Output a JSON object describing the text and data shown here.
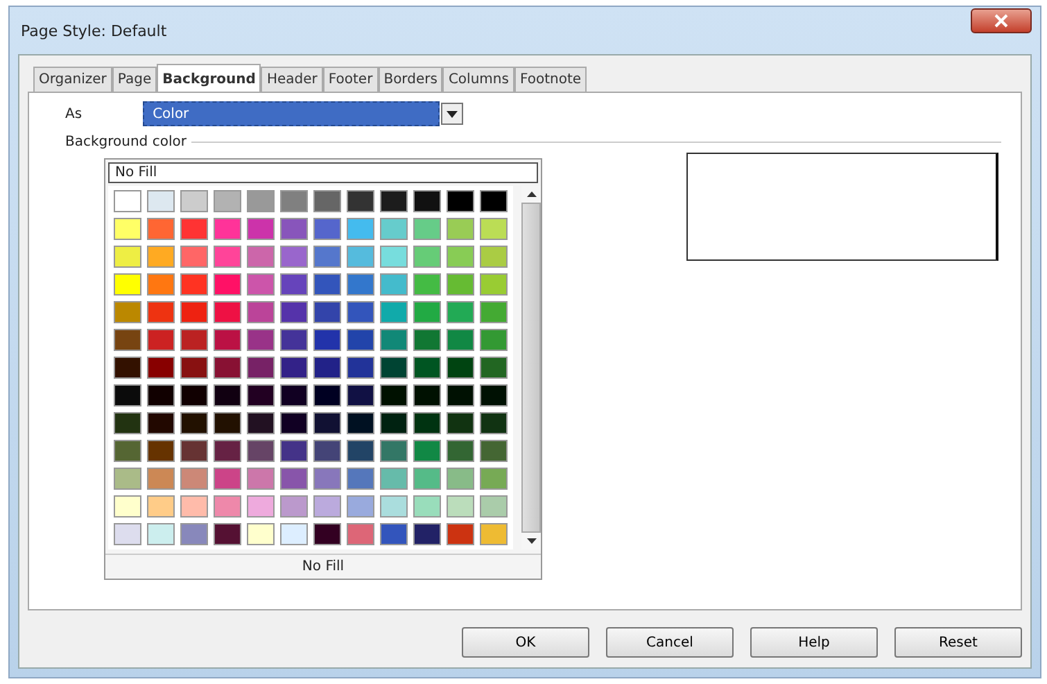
{
  "window": {
    "title": "Page Style: Default"
  },
  "tabs": [
    {
      "label": "Organizer",
      "selected": false
    },
    {
      "label": "Page",
      "selected": false
    },
    {
      "label": "Background",
      "selected": true
    },
    {
      "label": "Header",
      "selected": false
    },
    {
      "label": "Footer",
      "selected": false
    },
    {
      "label": "Borders",
      "selected": false
    },
    {
      "label": "Columns",
      "selected": false
    },
    {
      "label": "Footnote",
      "selected": false
    }
  ],
  "as_field": {
    "label": "As",
    "value": "Color"
  },
  "section_title": "Background color",
  "palette": {
    "top_value": "No Fill",
    "bottom_label": "No Fill",
    "rows": [
      [
        {
          "color": "#ffffff"
        },
        {
          "color": "#dde8f0"
        },
        {
          "color": "#cccccc"
        },
        {
          "color": "#b2b2b2"
        },
        {
          "color": "#999999"
        },
        {
          "color": "#808080"
        },
        {
          "color": "#666666"
        },
        {
          "color": "#333333"
        },
        {
          "color": "#1c1c1c"
        },
        {
          "color": "#111111"
        },
        {
          "color": "#000000"
        },
        {
          "color": "#000000"
        }
      ],
      [
        {
          "color": "#ffff66"
        },
        {
          "color": "#ff6633"
        },
        {
          "color": "#ff3333"
        },
        {
          "color": "#ff3399"
        },
        {
          "color": "#cc33aa"
        },
        {
          "color": "#8855bb"
        },
        {
          "color": "#5566cc"
        },
        {
          "color": "#44bbee"
        },
        {
          "color": "#66cccc"
        },
        {
          "color": "#66cc88"
        },
        {
          "color": "#99cc55"
        },
        {
          "color": "#bbdd55"
        }
      ],
      [
        {
          "color": "#eeee44"
        },
        {
          "color": "#ffaa22"
        },
        {
          "color": "#ff6666"
        },
        {
          "color": "#ff4499"
        },
        {
          "color": "#cc66aa"
        },
        {
          "color": "#9966cc"
        },
        {
          "color": "#5577cc"
        },
        {
          "color": "#55bbdd"
        },
        {
          "color": "#77dddd"
        },
        {
          "color": "#66cc77"
        },
        {
          "color": "#88cc55"
        },
        {
          "color": "#aacc44"
        }
      ],
      [
        {
          "color": "#ffff00"
        },
        {
          "color": "#ff7711"
        },
        {
          "color": "#ff3322"
        },
        {
          "color": "#ff1166"
        },
        {
          "color": "#cc55aa"
        },
        {
          "color": "#6644bb"
        },
        {
          "color": "#3355bb"
        },
        {
          "color": "#3377cc"
        },
        {
          "color": "#44bbcc"
        },
        {
          "color": "#44bb44"
        },
        {
          "color": "#66bb33"
        },
        {
          "color": "#99cc33"
        }
      ],
      [
        {
          "color": "#bb8800"
        },
        {
          "color": "#ee3311"
        },
        {
          "color": "#ee2211"
        },
        {
          "color": "#ee1144"
        },
        {
          "color": "#bb4499"
        },
        {
          "color": "#5533aa"
        },
        {
          "color": "#3344aa"
        },
        {
          "color": "#3355bb"
        },
        {
          "color": "#11aaaa"
        },
        {
          "color": "#22aa44"
        },
        {
          "color": "#22aa55"
        },
        {
          "color": "#44aa33"
        }
      ],
      [
        {
          "color": "#774411"
        },
        {
          "color": "#cc2222"
        },
        {
          "color": "#bb2222"
        },
        {
          "color": "#bb1144"
        },
        {
          "color": "#993388"
        },
        {
          "color": "#443399"
        },
        {
          "color": "#2233aa"
        },
        {
          "color": "#2244aa"
        },
        {
          "color": "#118877"
        },
        {
          "color": "#117733"
        },
        {
          "color": "#118844"
        },
        {
          "color": "#339933"
        }
      ],
      [
        {
          "color": "#331100"
        },
        {
          "color": "#880000"
        },
        {
          "color": "#881111"
        },
        {
          "color": "#881133"
        },
        {
          "color": "#772266"
        },
        {
          "color": "#332288"
        },
        {
          "color": "#222288"
        },
        {
          "color": "#223399"
        },
        {
          "color": "#004433"
        },
        {
          "color": "#005522"
        },
        {
          "color": "#004411"
        },
        {
          "color": "#226622"
        }
      ],
      [
        {
          "color": "#0b0b0b"
        },
        {
          "color": "#110000"
        },
        {
          "color": "#110001"
        },
        {
          "color": "#110011"
        },
        {
          "color": "#220022"
        },
        {
          "color": "#110022"
        },
        {
          "color": "#000022"
        },
        {
          "color": "#111144"
        },
        {
          "color": "#001100"
        },
        {
          "color": "#001101"
        },
        {
          "color": "#001102"
        },
        {
          "color": "#001103"
        }
      ],
      [
        {
          "color": "#223311"
        },
        {
          "color": "#220800"
        },
        {
          "color": "#221100"
        },
        {
          "color": "#221101"
        },
        {
          "color": "#221122"
        },
        {
          "color": "#110023"
        },
        {
          "color": "#111133"
        },
        {
          "color": "#001122"
        },
        {
          "color": "#002211"
        },
        {
          "color": "#003311"
        },
        {
          "color": "#113311"
        },
        {
          "color": "#113312"
        }
      ],
      [
        {
          "color": "#556633"
        },
        {
          "color": "#663300"
        },
        {
          "color": "#663333"
        },
        {
          "color": "#662244"
        },
        {
          "color": "#664466"
        },
        {
          "color": "#443388"
        },
        {
          "color": "#444477"
        },
        {
          "color": "#224466"
        },
        {
          "color": "#337766"
        },
        {
          "color": "#118845"
        },
        {
          "color": "#336633"
        },
        {
          "color": "#446633"
        }
      ],
      [
        {
          "color": "#aabb88"
        },
        {
          "color": "#cc8855"
        },
        {
          "color": "#cc8877"
        },
        {
          "color": "#cc4488"
        },
        {
          "color": "#cc77aa"
        },
        {
          "color": "#8855aa"
        },
        {
          "color": "#8877bb"
        },
        {
          "color": "#5577bb"
        },
        {
          "color": "#66bbaa"
        },
        {
          "color": "#55bb88"
        },
        {
          "color": "#88bb88"
        },
        {
          "color": "#77aa55"
        }
      ],
      [
        {
          "color": "#ffffcc"
        },
        {
          "color": "#ffcc88"
        },
        {
          "color": "#ffbbaa"
        },
        {
          "color": "#ee88aa"
        },
        {
          "color": "#eeaadd"
        },
        {
          "color": "#bb99cc"
        },
        {
          "color": "#bbaadd"
        },
        {
          "color": "#99aadd"
        },
        {
          "color": "#aadddd"
        },
        {
          "color": "#99ddbb"
        },
        {
          "color": "#bbddbb"
        },
        {
          "color": "#aaccaa"
        }
      ],
      [
        {
          "color": "#ddddee"
        },
        {
          "color": "#cceeee"
        },
        {
          "color": "#8888bb"
        },
        {
          "color": "#551133"
        },
        {
          "color": "#ffffcd"
        },
        {
          "color": "#ddeeff"
        },
        {
          "color": "#330022"
        },
        {
          "color": "#dd6677"
        },
        {
          "color": "#3355bc"
        },
        {
          "color": "#222266"
        },
        {
          "color": "#cc3311"
        },
        {
          "color": "#eebb33"
        }
      ]
    ]
  },
  "buttons": [
    "OK",
    "Cancel",
    "Help",
    "Reset"
  ]
}
